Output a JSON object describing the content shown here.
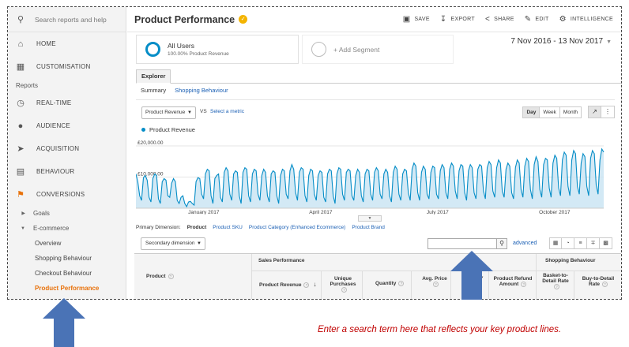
{
  "sidebar": {
    "search_placeholder": "Search reports and help",
    "items_top": [
      {
        "label": "HOME",
        "icon": "home-icon"
      },
      {
        "label": "CUSTOMISATION",
        "icon": "dashboard-icon"
      }
    ],
    "section_label": "Reports",
    "items_reports": [
      {
        "label": "REAL-TIME",
        "icon": "clock-icon"
      },
      {
        "label": "AUDIENCE",
        "icon": "person-icon"
      },
      {
        "label": "ACQUISITION",
        "icon": "acquisition-icon"
      },
      {
        "label": "BEHAVIOUR",
        "icon": "behaviour-icon"
      },
      {
        "label": "CONVERSIONS",
        "icon": "flag-icon"
      }
    ],
    "goals": "Goals",
    "ecommerce": "E-commerce",
    "ecommerce_items": [
      "Overview",
      "Shopping Behaviour",
      "Checkout Behaviour",
      "Product Performance"
    ]
  },
  "header": {
    "title": "Product Performance",
    "actions": [
      "SAVE",
      "EXPORT",
      "SHARE",
      "EDIT",
      "INTELLIGENCE"
    ]
  },
  "segment": {
    "name": "All Users",
    "sub": "100.00% Product Revenue",
    "add_label": "+ Add Segment"
  },
  "date_range": "7 Nov 2016 - 13 Nov 2017",
  "tabs": {
    "explorer": "Explorer",
    "summary": "Summary",
    "shopping": "Shopping Behaviour"
  },
  "chart_controls": {
    "metric": "Product Revenue",
    "vs": "VS",
    "select_metric": "Select a metric",
    "periods": [
      "Day",
      "Week",
      "Month"
    ],
    "active_period": "Day"
  },
  "chart_data": {
    "type": "area",
    "series": [
      {
        "name": "Product Revenue"
      }
    ],
    "ytick_labels": [
      "£20,000.00",
      "£10,000.00"
    ],
    "ylim": [
      0,
      20000
    ],
    "xtick_labels": [
      "January 2017",
      "April 2017",
      "July 2017",
      "October 2017"
    ],
    "values": [
      11000,
      8500,
      4000,
      2500,
      9800,
      10500,
      9000,
      3500,
      2000,
      9500,
      11000,
      10500,
      3000,
      1500,
      8500,
      9500,
      9000,
      4000,
      3500,
      8000,
      9500,
      8500,
      2500,
      1500,
      3500,
      4000,
      1500,
      500,
      2000,
      2200,
      1500,
      1000,
      8500,
      9800,
      9500,
      4500,
      3000,
      11000,
      12500,
      12000,
      4000,
      1500,
      9500,
      10500,
      11000,
      3500,
      2000,
      11500,
      13000,
      12000,
      4500,
      2500,
      11000,
      12000,
      11500,
      4000,
      1500,
      11500,
      13000,
      12500,
      4000,
      2000,
      11000,
      12500,
      12000,
      4500,
      2500,
      10500,
      12500,
      11500,
      4000,
      2000,
      11000,
      12000,
      11500,
      4000,
      1500,
      10500,
      12500,
      12000,
      4500,
      3000,
      12000,
      14000,
      12500,
      5000,
      2500,
      11500,
      13000,
      12500,
      4000,
      2000,
      10500,
      12500,
      12000,
      4500,
      2500,
      10500,
      12000,
      11500,
      3500,
      2000,
      11000,
      12500,
      12000,
      4000,
      1500,
      11000,
      13000,
      12500,
      4500,
      2500,
      11500,
      12500,
      12000,
      4000,
      2500,
      10500,
      12500,
      11500,
      4000,
      2000,
      11000,
      12500,
      12000,
      4500,
      2500,
      11500,
      13000,
      12000,
      4500,
      3000,
      11000,
      12500,
      11500,
      4000,
      2000,
      11500,
      13500,
      12500,
      4500,
      2500,
      11000,
      12500,
      12000,
      5000,
      2500,
      12500,
      14500,
      13500,
      5000,
      2500,
      11500,
      13500,
      12500,
      4500,
      3000,
      11500,
      13500,
      13000,
      4500,
      3000,
      12000,
      14000,
      13000,
      5000,
      3000,
      12500,
      14500,
      13500,
      5500,
      3000,
      12000,
      14000,
      13500,
      5000,
      2500,
      12000,
      14000,
      13000,
      5000,
      3000,
      12500,
      14000,
      13500,
      5500,
      3000,
      13000,
      15000,
      14000,
      5500,
      3500,
      13000,
      15500,
      14500,
      5500,
      3500,
      12500,
      14500,
      13500,
      5000,
      3000,
      13000,
      15500,
      14500,
      6000,
      3500,
      13500,
      16000,
      15000,
      6000,
      3000,
      14000,
      16500,
      15000,
      6000,
      3500,
      14000,
      16000,
      15500,
      6500,
      3500,
      14500,
      17000,
      16000,
      6500,
      4000,
      15500,
      18000,
      17000,
      7000,
      4000,
      15500,
      18500,
      17500,
      7000,
      4500,
      14500,
      17500,
      16500,
      7000,
      4000,
      16000,
      18500,
      17500,
      7500,
      4500,
      15500,
      19000,
      18000
    ]
  },
  "primary_dimension": {
    "label": "Primary Dimension:",
    "current": "Product",
    "options": [
      "Product SKU",
      "Product Category (Enhanced Ecommerce)",
      "Product Brand"
    ]
  },
  "table_controls": {
    "secondary": "Secondary dimension",
    "advanced": "advanced"
  },
  "table": {
    "product_col": "Product",
    "group_sales": "Sales Performance",
    "group_shopping": "Shopping Behaviour",
    "cols": {
      "revenue": "Product Revenue",
      "unique_1": "Unique",
      "unique_2": "Purchases",
      "quantity": "Quantity",
      "avg_price": "Avg. Price",
      "avg_qty": "g. QTY",
      "refund_1": "Product Refund",
      "refund_2": "Amount",
      "b2d_1": "Basket-to-",
      "b2d_2": "Detail Rate",
      "b2detail_1": "Buy-to-Detail",
      "b2detail_2": "Rate"
    }
  },
  "annotation": "Enter a search term here that reflects your key product lines.",
  "colors": {
    "accent": "#e8710a",
    "series": "#058dc7",
    "arrow": "#4a73b6",
    "note": "#c00000"
  }
}
